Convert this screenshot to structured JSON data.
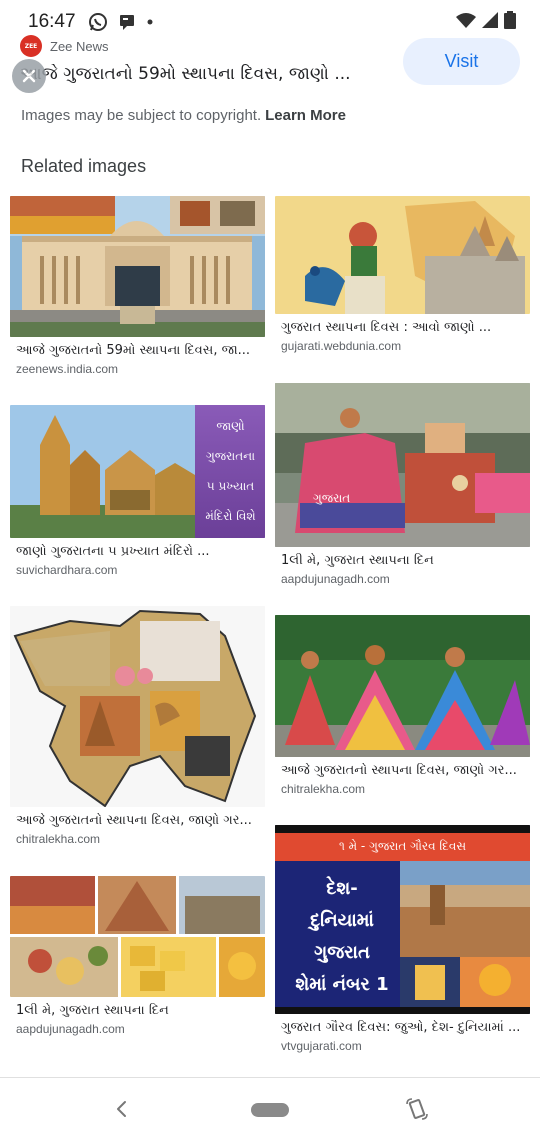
{
  "status_bar": {
    "time": "16:47",
    "icons": [
      "whatsapp-icon",
      "message-icon",
      "dot-icon"
    ],
    "right_icons": [
      "wifi-icon",
      "signal-icon",
      "battery-icon"
    ]
  },
  "source": {
    "name": "Zee News",
    "logo_text": "ZEE"
  },
  "title": "આજે ગુજરાતનો 59મો સ્થાપના દિવસ, જાણો ...",
  "visit_label": "Visit",
  "copyright_text": "Images may be subject to copyright.",
  "learn_more_label": "Learn More",
  "related_heading": "Related images",
  "left_column": [
    {
      "caption": "આજે ગુજરાતનો 59મો સ્થાપના દિવસ, જા...",
      "domain": "zeenews.india.com"
    },
    {
      "caption": "જાણો ગુજરાતના ૫ પ્રખ્યાત મંદિરો ...",
      "domain": "suvichardhara.com",
      "overlay_words": [
        "જાણો",
        "ગુજરાતના",
        "૫ પ્રખ્યાત",
        "મંદિરો વિશે"
      ]
    },
    {
      "caption": "આજે ગુજરાતનો સ્થાપના દિવસ, જાણો ગર...",
      "domain": "chitralekha.com"
    },
    {
      "caption": "1લી મે, ગુજરાત સ્થાપના દિન",
      "domain": "aapdujunagadh.com"
    }
  ],
  "right_column": [
    {
      "caption": "ગુજરાત સ્થાપના દિવસ : આવો જાણો ...",
      "domain": "gujarati.webdunia.com"
    },
    {
      "caption": "1લી મે, ગુજરાત સ્થાપના દિન",
      "domain": "aapdujunagadh.com",
      "overlay_words": [
        "ગુજરાત"
      ]
    },
    {
      "caption": "આજે ગુજરાતનો સ્થાપના દિવસ, જાણો ગર...",
      "domain": "chitralekha.com"
    },
    {
      "caption": "ગુજરાત ગૌરવ દિવસ: જુઓ, દેશ- દુનિયામાં ...",
      "domain": "vtvgujarati.com",
      "banner": "૧ મે - ગુજરાત ગૌરવ દિવસ",
      "overlay_words": [
        "દેશ-",
        "દુનિયામાં",
        "ગુજરાત",
        "શેમાં નંબર 1"
      ]
    }
  ],
  "nav": {
    "back": "back-icon",
    "home": "home-pill",
    "rotate": "rotate-icon"
  }
}
